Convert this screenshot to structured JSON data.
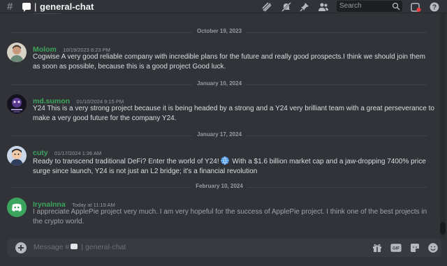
{
  "header": {
    "hash_symbol": "#",
    "separator": "|",
    "channel_name": "general-chat",
    "search_placeholder": "Search",
    "icons": [
      "threads-icon",
      "mute-icon",
      "pin-icon",
      "members-icon",
      "search-icon",
      "inbox-icon",
      "help-icon"
    ]
  },
  "messages": {
    "dividers": [
      "October 19, 2023",
      "January 10, 2024",
      "January 17, 2024",
      "February 10, 2024"
    ],
    "items": [
      {
        "author": "Molom",
        "timestamp": "10/19/2023 8:23 PM",
        "text": "Cogwise A very good reliable company with incredible plans for the future and really good prospects.I think we should join them as soon as possible, because this is a good project Good luck."
      },
      {
        "author": "md.sumon",
        "timestamp": "01/10/2024 9:15 PM",
        "text": "Y24 This is a very strong project because it is being headed by a strong and a Y24  very brilliant team with a great perseverance to make a very good future for the company Y24."
      },
      {
        "author": "cuty",
        "timestamp": "01/17/2024 1:36 AM",
        "text_before_emoji": "Ready to transcend traditional DeFi? Enter the world of Y24!",
        "emoji": "globe-icon",
        "text_after_emoji": " With a $1.6 billion market cap and a jaw-dropping 7400% price surge since launch, Y24 is not just an L2 bridge; it's a financial revolution"
      },
      {
        "author": "Irynalnna",
        "timestamp": "Today at 11:19 AM",
        "text": "I appreciate ApplePie project very much. I am very hopeful for the success of ApplePie project. I think one of the best projects in the crypto world."
      }
    ]
  },
  "composer": {
    "placeholder_prefix": "Message #",
    "placeholder_separator": "|",
    "placeholder_channel": "general-chat",
    "icons": [
      "add-icon",
      "gift-icon",
      "gif-icon",
      "sticker-icon",
      "emoji-icon"
    ],
    "gif_label": "GIF"
  },
  "colors": {
    "background": "#313338",
    "username": "#3ba55d",
    "divider_text": "#949ba4",
    "message_text": "#dbdee1",
    "composer": "#383a40"
  }
}
